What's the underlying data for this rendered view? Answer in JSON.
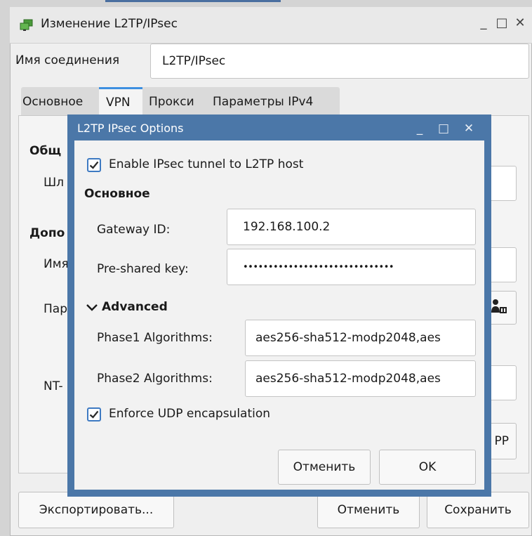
{
  "main_window": {
    "title": "Изменение L2TP/IPsec",
    "minimize": "_",
    "maximize": "□",
    "close": "✕",
    "connection_name_label": "Имя соединения",
    "connection_name_value": "L2TP/IPsec",
    "tabs": [
      {
        "label": "Основное",
        "active": false
      },
      {
        "label": "VPN",
        "active": true
      },
      {
        "label": "Прокси",
        "active": false
      },
      {
        "label": "Параметры IPv4",
        "active": false
      }
    ],
    "partial_labels": {
      "general": "Общ",
      "gateway": "Шл",
      "additional": "Допо",
      "username": "Имя",
      "password": "Пар",
      "nt": "NT-"
    },
    "partial_button": "PP",
    "export_button": "Экспортировать...",
    "cancel_button": "Отменить",
    "save_button": "Сохранить"
  },
  "dialog": {
    "title": "L2TP IPsec Options",
    "minimize": "_",
    "maximize": "□",
    "close": "✕",
    "enable_ipsec_label": "Enable IPsec tunnel to L2TP host",
    "enable_ipsec_checked": true,
    "section_basic": "Основное",
    "gateway_id_label": "Gateway ID:",
    "gateway_id_value": "192.168.100.2",
    "psk_label": "Pre-shared key:",
    "psk_value": "••••••••••••••••••••••••••••••",
    "advanced_label": "Advanced",
    "phase1_label": "Phase1 Algorithms:",
    "phase1_value": "aes256-sha512-modp2048,aes",
    "phase2_label": "Phase2 Algorithms:",
    "phase2_value": "aes256-sha512-modp2048,aes",
    "enforce_udp_label": "Enforce UDP encapsulation",
    "enforce_udp_checked": true,
    "cancel_button": "Отменить",
    "ok_button": "OK"
  },
  "colors": {
    "dialog_frame": "#4b77a8",
    "checkbox_accent": "#3e7ac2",
    "tab_active_accent": "#3d8fe0"
  }
}
